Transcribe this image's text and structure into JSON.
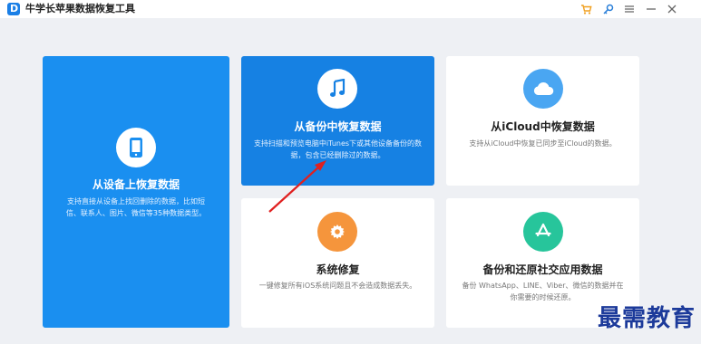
{
  "app": {
    "logo_letter": "D",
    "title": "牛学长苹果数据恢复工具"
  },
  "titlebar_icons": [
    "cart-icon",
    "key-icon",
    "menu-icon",
    "minimize-icon",
    "close-icon"
  ],
  "cards": {
    "device": {
      "title": "从设备上恢复数据",
      "desc": "支持直接从设备上找回删除的数据，比如短信、联系人、图片、微信等35种数据类型。"
    },
    "itunes": {
      "title": "从备份中恢复数据",
      "desc": "支持扫描和预览电脑中iTunes下或其他设备备份的数据，包含已经删除过的数据。"
    },
    "icloud": {
      "title": "从iCloud中恢复数据",
      "desc": "支持从iCloud中恢复已同步至iCloud的数据。"
    },
    "repair": {
      "title": "系统修复",
      "desc": "一键修复所有iOS系统问题且不会造成数据丢失。"
    },
    "social": {
      "title": "备份和还原社交应用数据",
      "desc": "备份 WhatsApp、LINE、Viber、微信的数据并在你需要的时候还原。"
    }
  },
  "watermark": "最需教育",
  "colors": {
    "accent": "#1a8ff0",
    "accent_dark": "#1681e3",
    "orange": "#f5953c",
    "teal": "#27c59b",
    "sky": "#4aa6f2",
    "arrow": "#e02020"
  }
}
